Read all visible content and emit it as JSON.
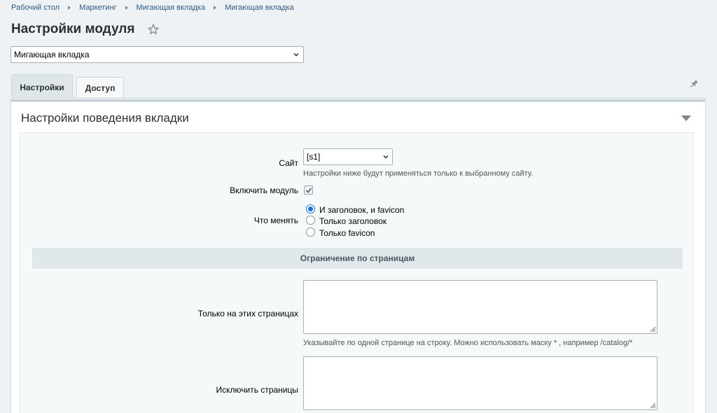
{
  "breadcrumb": [
    "Рабочий стол",
    "Маркетинг",
    "Мигающая вкладка",
    "Мигающая вкладка"
  ],
  "page_title": "Настройки модуля",
  "module_select": {
    "value": "Мигающая вкладка"
  },
  "tabs": [
    {
      "label": "Настройки",
      "active": true
    },
    {
      "label": "Доступ",
      "active": false
    }
  ],
  "section": {
    "title": "Настройки поведения вкладки"
  },
  "form": {
    "site_label": "Сайт",
    "site_value": "[s1]",
    "site_hint": "Настройки ниже будут применяться только к выбранному сайту.",
    "enable_label": "Включить модуль",
    "enable_checked": true,
    "change_label": "Что менять",
    "change_options": [
      {
        "label": "И заголовок, и favicon",
        "checked": true
      },
      {
        "label": "Только заголовок",
        "checked": false
      },
      {
        "label": "Только favicon",
        "checked": false
      }
    ],
    "subheader": "Ограничение по страницам",
    "only_pages_label": "Только на этих страницах",
    "only_pages_value": "",
    "only_pages_hint": "Указывайте по одной странице на строку. Можно использовать маску * , например /catalog/*",
    "exclude_pages_label": "Исключить страницы",
    "exclude_pages_value": ""
  },
  "colors": {
    "accent": "#1d6fd6",
    "link": "#2f5b83",
    "background": "#eef2f4"
  }
}
